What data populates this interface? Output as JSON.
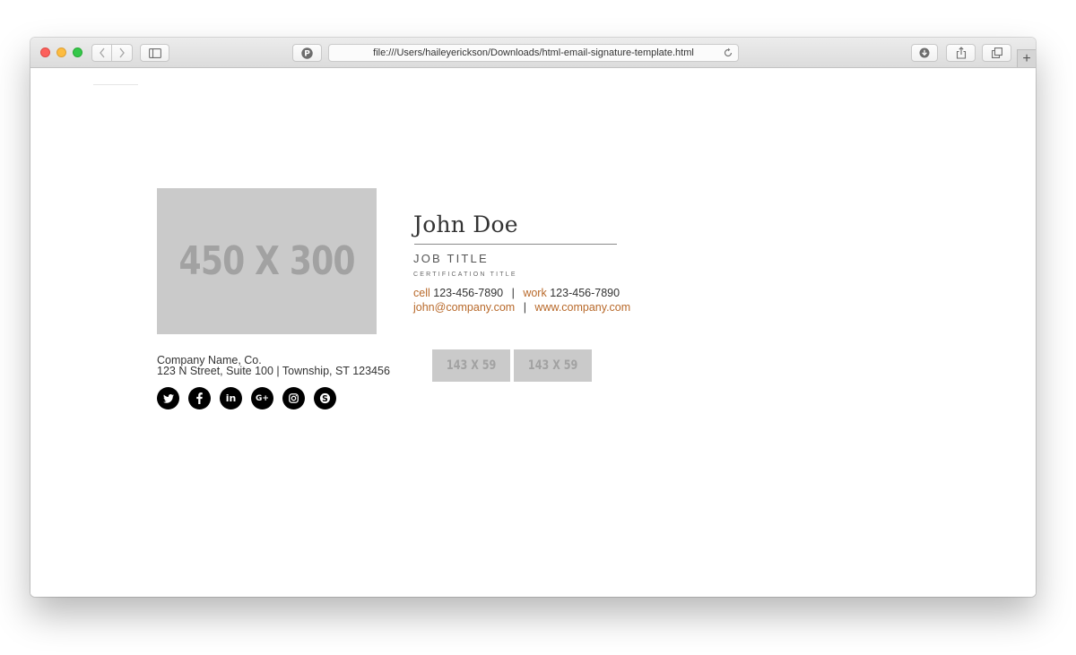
{
  "browser": {
    "address": "file:///Users/haileyerickson/Downloads/html-email-signature-template.html",
    "new_tab_label": "+"
  },
  "signature": {
    "photo_placeholder": "450 X 300",
    "name": "John Doe",
    "job_title": "JOB TITLE",
    "certification_title": "CERTIFICATION TITLE",
    "cell_label": "cell",
    "cell_number": "123-456-7890",
    "work_label": "work",
    "work_number": "123-456-7890",
    "separator": "|",
    "email": "john@company.com",
    "website": "www.company.com",
    "badge_placeholders": [
      "143 X 59",
      "143 X 59"
    ],
    "company_name": "Company Name, Co.",
    "address": "123 N Street, Suite 100 | Township, ST 123456",
    "social_icons": [
      "twitter-icon",
      "facebook-icon",
      "linkedin-icon",
      "google-plus-icon",
      "instagram-icon",
      "skype-icon"
    ],
    "social_glyphs": {
      "linkedin": "in",
      "google_plus": "G+"
    },
    "accent_color": "#b8692a"
  }
}
